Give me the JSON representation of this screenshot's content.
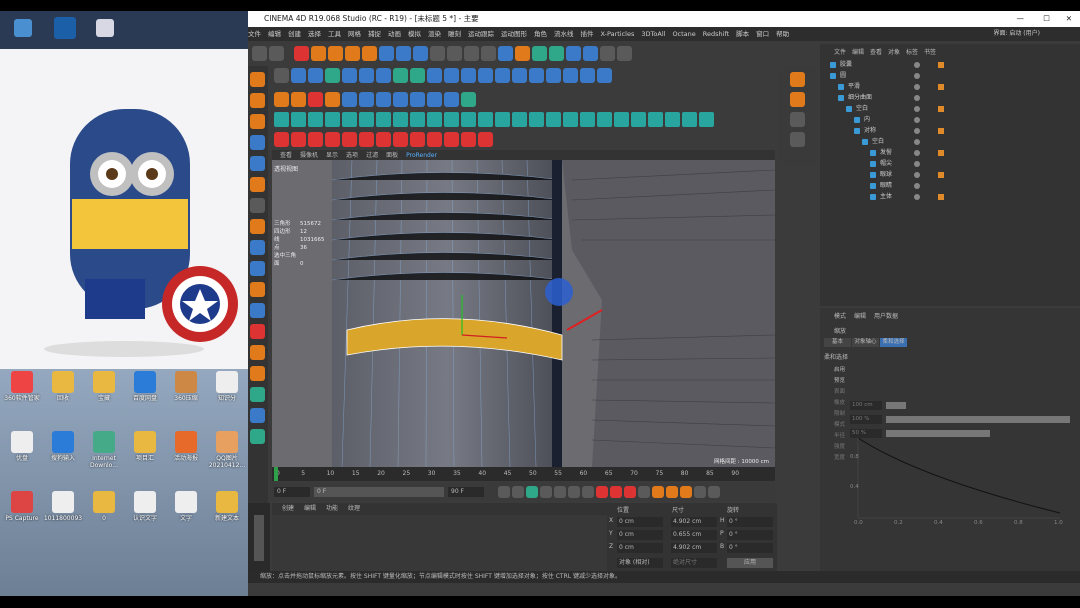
{
  "window": {
    "title": "CINEMA 4D R19.068 Studio (RC - R19) - [未标题 5 *] - 主要"
  },
  "menu": [
    "文件",
    "编辑",
    "创建",
    "选择",
    "工具",
    "网格",
    "捕捉",
    "动画",
    "模拟",
    "渲染",
    "雕刻",
    "运动跟踪",
    "运动图形",
    "角色",
    "流水线",
    "插件",
    "X-Particles",
    "3DToAll",
    "Octane",
    "Redshift",
    "脚本",
    "窗口",
    "帮助"
  ],
  "layout_label": "界面: 启动 (用户)",
  "viewport": {
    "menu": [
      "查看",
      "摄像机",
      "显示",
      "选项",
      "过滤",
      "面板",
      "ProRender"
    ],
    "name": "透视视图",
    "stats": [
      {
        "k": "三角形",
        "v": "515672"
      },
      {
        "k": "四边形",
        "v": "12"
      },
      {
        "k": "线",
        "v": "1031665"
      },
      {
        "k": "点",
        "v": "36"
      },
      {
        "k": "选中三角面",
        "v": "0"
      }
    ],
    "grid_label": "网格间距 : 10000 cm"
  },
  "timeline": {
    "ticks": [
      "0",
      "5",
      "10",
      "15",
      "20",
      "25",
      "30",
      "35",
      "40",
      "45",
      "50",
      "55",
      "60",
      "65",
      "70",
      "75",
      "80",
      "85",
      "90"
    ],
    "end": "0 F"
  },
  "transport": {
    "start": "0 F",
    "cur": "0 F",
    "end": "90 F",
    "max": "90 F"
  },
  "material": {
    "menu": [
      "创建",
      "编辑",
      "功能",
      "纹理"
    ]
  },
  "coords": {
    "headers": [
      "位置",
      "尺寸",
      "旋转"
    ],
    "rows": [
      {
        "a": "X",
        "p": "0 cm",
        "s": "4.902 cm",
        "r": "H",
        "rv": "0 °"
      },
      {
        "a": "Y",
        "p": "0 cm",
        "s": "0.655 cm",
        "r": "P",
        "rv": "0 °"
      },
      {
        "a": "Z",
        "p": "0 cm",
        "s": "4.902 cm",
        "r": "B",
        "rv": "0 °"
      }
    ],
    "mode": "对象 (相对)",
    "size_mode": "绝对尺寸",
    "apply": "应用"
  },
  "objects": {
    "menu": [
      "文件",
      "编辑",
      "查看",
      "对象",
      "标签",
      "书签"
    ],
    "items": [
      "胶囊",
      "圆",
      "平滑",
      "细分曲面",
      "空白",
      "内",
      "对称",
      "空白",
      "发髻",
      "帽尖",
      "眼球",
      "眼睛",
      "主体"
    ]
  },
  "attributes": {
    "menu": [
      "模式",
      "编辑",
      "用户数据"
    ],
    "object": "缩放",
    "tabs": [
      "基本",
      "对象轴心",
      "柔和选择"
    ],
    "section": "柔和选择",
    "fields": [
      "启用",
      "预览",
      "表面",
      "橡皮",
      "限制",
      "模式",
      "半径",
      "强度",
      "宽度"
    ],
    "values": [
      "100 cm",
      "100 %",
      "50 %"
    ],
    "curve_ticks": [
      "0.0",
      "0.2",
      "0.4",
      "0.6",
      "0.8",
      "1.0"
    ],
    "curve_yticks": [
      "0.8",
      "0.4"
    ]
  },
  "status": "缩放：点击并拖动鼠标缩放元素。按住 SHIFT 键量化缩放；节点编辑模式时按住 SHIFT 键增加选择对象；按住 CTRL 键减少选择对象。",
  "desktop": {
    "icons": [
      "360软件管家",
      "回收",
      "宝藏",
      "百度网盘",
      "360压缩",
      "知识分",
      "优盘",
      "搜狗输入",
      "Internet Downlo...",
      "项目汇",
      "活动海报",
      "QQ图片 20210412...",
      "PS Capture",
      "1011800093",
      "0",
      "认识文字",
      "文字",
      "新建文本"
    ]
  }
}
